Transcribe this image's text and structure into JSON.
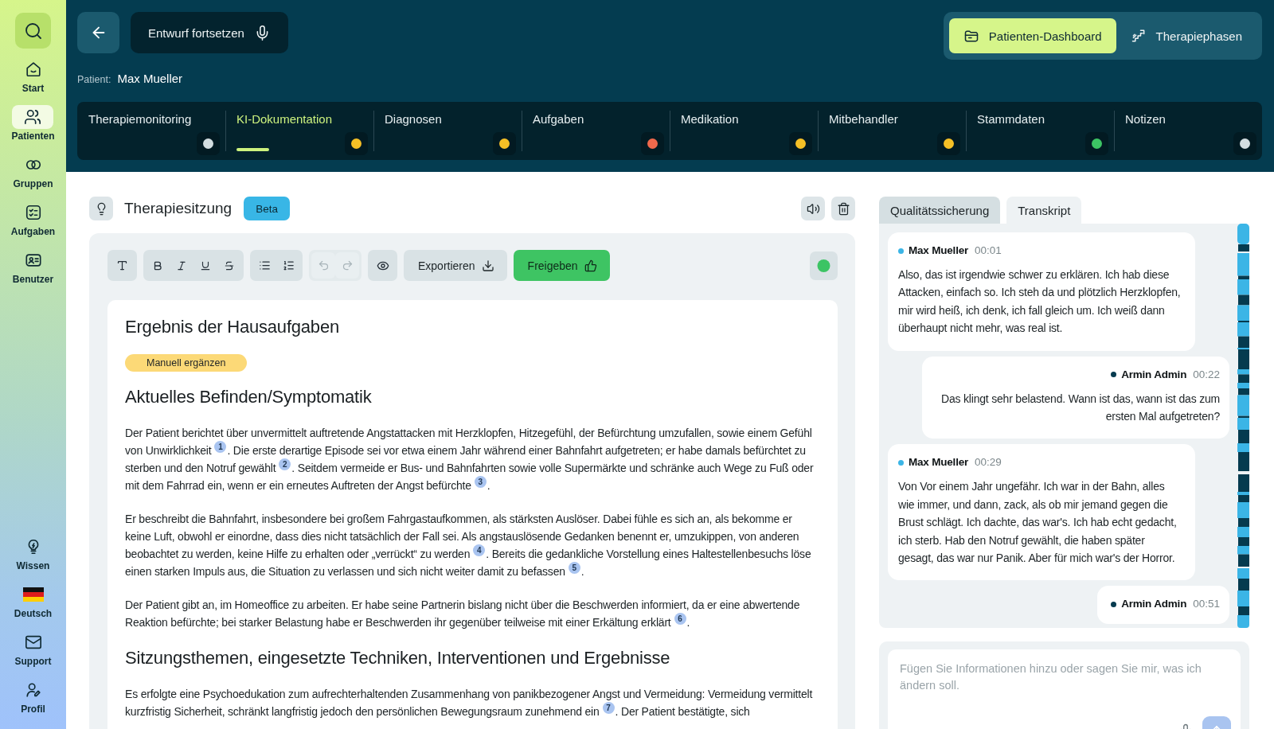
{
  "sidebar": {
    "items": [
      {
        "label": "Start",
        "selected": false
      },
      {
        "label": "Patienten",
        "selected": true
      },
      {
        "label": "Gruppen",
        "selected": false
      },
      {
        "label": "Aufgaben",
        "selected": false
      },
      {
        "label": "Benutzer",
        "selected": false
      }
    ],
    "footer_items": [
      {
        "label": "Wissen"
      },
      {
        "label": "Deutsch"
      },
      {
        "label": "Support"
      },
      {
        "label": "Profil"
      }
    ]
  },
  "header": {
    "draft_button": "Entwurf fortsetzen",
    "patient_label": "Patient:",
    "patient_name": "Max Mueller",
    "views": [
      {
        "label": "Patienten-Dashboard",
        "selected": true
      },
      {
        "label": "Therapiephasen",
        "selected": false
      }
    ]
  },
  "tabs": [
    {
      "label": "Therapiemonitoring",
      "selected": false,
      "color": "#d3dde0"
    },
    {
      "label": "KI-Dokumentation",
      "selected": true,
      "color": "#f6c026"
    },
    {
      "label": "Diagnosen",
      "selected": false,
      "color": "#f6c026"
    },
    {
      "label": "Aufgaben",
      "selected": false,
      "color": "#f0694c"
    },
    {
      "label": "Medikation",
      "selected": false,
      "color": "#f6c026"
    },
    {
      "label": "Mitbehandler",
      "selected": false,
      "color": "#f6c026"
    },
    {
      "label": "Stammdaten",
      "selected": false,
      "color": "#3cc464"
    },
    {
      "label": "Notizen",
      "selected": false,
      "color": "#d3dde0"
    }
  ],
  "session": {
    "title": "Therapiesitzung",
    "badge": "Beta"
  },
  "toolbar": {
    "history": [
      {
        "disabled": true
      },
      {
        "disabled": true
      }
    ],
    "export": "Exportieren",
    "release": "Freigeben"
  },
  "document": {
    "blocks": [
      {
        "kind": "heading",
        "text": "Ergebnis der Hausaufgaben"
      },
      {
        "kind": "tag",
        "text": "Manuell ergänzen"
      },
      {
        "kind": "heading",
        "text": "Aktuelles Befinden/Symptomatik"
      },
      {
        "kind": "paragraph",
        "parts": [
          {
            "text": "Der Patient berichtet über unvermittelt auftretende Angstattacken mit Herzklopfen, Hitzegefühl, der Befürchtung umzufallen, sowie einem Gefühl von Unwirklichkeit",
            "ref": "1"
          },
          {
            "text": ". Die erste derartige Episode sei vor etwa einem Jahr während einer Bahnfahrt aufgetreten; er habe damals befürchtet zu sterben und den Notruf gewählt",
            "ref": "2"
          },
          {
            "text": ". Seitdem vermeide er Bus- und Bahnfahrten sowie volle Supermärkte und schränke auch Wege zu Fuß oder mit dem Fahrrad ein, wenn er ein erneutes Auftreten der Angst befürchte",
            "ref": "3"
          },
          {
            "text": "."
          }
        ]
      },
      {
        "kind": "paragraph",
        "parts": [
          {
            "text": "Er beschreibt die Bahnfahrt, insbesondere bei großem Fahrgastaufkommen, als stärksten Auslöser. Dabei fühle es sich an, als bekomme er keine Luft, obwohl er einordne, dass dies nicht tatsächlich der Fall sei. Als angstauslösende Gedanken benennt er, umzukippen, von anderen beobachtet zu werden, keine Hilfe zu erhalten oder „verrückt“ zu werden",
            "ref": "4"
          },
          {
            "text": ". Bereits die gedankliche Vorstellung eines Haltestellenbesuchs löse einen starken Impuls aus, die Situation zu verlassen und sich nicht weiter damit zu befassen",
            "ref": "5"
          },
          {
            "text": "."
          }
        ]
      },
      {
        "kind": "paragraph",
        "parts": [
          {
            "text": "Der Patient gibt an, im Homeoffice zu arbeiten. Er habe seine Partnerin bislang nicht über die Beschwerden informiert, da er eine abwertende Reaktion befürchte; bei starker Belastung habe er Beschwerden ihr gegenüber teilweise mit einer Erkältung erklärt",
            "ref": "6"
          },
          {
            "text": "."
          }
        ]
      },
      {
        "kind": "heading",
        "text": "Sitzungsthemen, eingesetzte Techniken, Interventionen und Ergebnisse"
      },
      {
        "kind": "paragraph",
        "parts": [
          {
            "text": "Es erfolgte eine Psychoedukation zum aufrechterhaltenden Zusammenhang von panikbezogener Angst und Vermeidung: Vermeidung vermittelt kurzfristig Sicherheit, schränkt langfristig jedoch den persönlichen Bewegungsraum zunehmend ein",
            "ref": "7"
          },
          {
            "text": ". Der Patient bestätigte, sich"
          }
        ]
      }
    ]
  },
  "side_panel": {
    "tabs": [
      {
        "label": "Qualitätssicherung",
        "selected": false
      },
      {
        "label": "Transkript",
        "selected": true
      }
    ],
    "messages": [
      {
        "kind": "patient",
        "speaker": "Max Mueller",
        "time": "00:01",
        "color": "#3bb5e6",
        "text": "Also, das ist irgendwie schwer zu erklären. Ich hab diese Attacken, einfach so. Ich steh da und plötzlich Herzklopfen, mir wird heiß, ich denk, ich fall gleich um. Ich weiß dann überhaupt nicht mehr, was real ist."
      },
      {
        "kind": "therapist",
        "speaker": "Armin Admin",
        "time": "00:22",
        "color": "#053b4f",
        "text": "Das klingt sehr belastend. Wann ist das, wann ist das zum ersten Mal aufgetreten?"
      },
      {
        "kind": "patient",
        "speaker": "Max Mueller",
        "time": "00:29",
        "color": "#3bb5e6",
        "text": "Von Vor einem Jahr ungefähr. Ich war in der Bahn, alles wie immer, und dann, zack, als ob mir jemand gegen die Brust schlägt. Ich dachte, das war's. Ich hab echt gedacht, ich sterb. Hab den Notruf gewählt, die haben später gesagt, das war nur Panik. Aber für mich war's der Horror."
      },
      {
        "kind": "therapist",
        "speaker": "Armin Admin",
        "time": "00:51",
        "color": "#053b4f"
      }
    ]
  },
  "composer": {
    "placeholder": "Fügen Sie Informationen hinzu oder sagen Sie mir, was ich ändern soll."
  }
}
